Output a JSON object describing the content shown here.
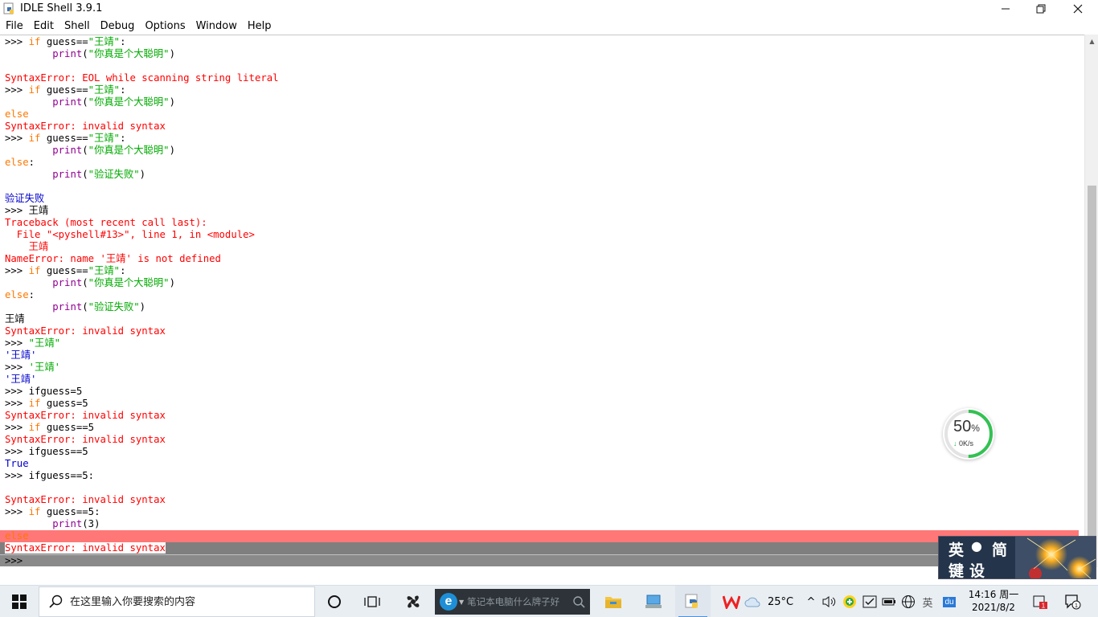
{
  "window": {
    "title": "IDLE Shell 3.9.1",
    "controls": {
      "minimize": "—",
      "restore": "❐",
      "close": "✕"
    }
  },
  "menu": [
    "File",
    "Edit",
    "Shell",
    "Debug",
    "Options",
    "Window",
    "Help"
  ],
  "shell": {
    "lines": [
      {
        "segs": [
          [
            "prompt",
            ">>> "
          ],
          [
            "kw",
            "if"
          ],
          [
            "plain",
            " guess=="
          ],
          [
            "str",
            "\"王靖\""
          ],
          [
            "plain",
            ":"
          ]
        ]
      },
      {
        "segs": [
          [
            "plain",
            "        "
          ],
          [
            "bi",
            "print"
          ],
          [
            "plain",
            "("
          ],
          [
            "str",
            "\"你真是个大聪明\""
          ],
          [
            "plain",
            ")"
          ]
        ]
      },
      {
        "segs": [
          [
            "plain",
            ""
          ]
        ]
      },
      {
        "segs": [
          [
            "err",
            "SyntaxError: EOL while scanning string literal"
          ]
        ]
      },
      {
        "segs": [
          [
            "prompt",
            ">>> "
          ],
          [
            "kw",
            "if"
          ],
          [
            "plain",
            " guess=="
          ],
          [
            "str",
            "\"王靖\""
          ],
          [
            "plain",
            ":"
          ]
        ]
      },
      {
        "segs": [
          [
            "plain",
            "        "
          ],
          [
            "bi",
            "print"
          ],
          [
            "plain",
            "("
          ],
          [
            "str",
            "\"你真是个大聪明\""
          ],
          [
            "plain",
            ")"
          ]
        ]
      },
      {
        "segs": [
          [
            "kw",
            "else"
          ]
        ]
      },
      {
        "segs": [
          [
            "err",
            "SyntaxError: invalid syntax"
          ]
        ]
      },
      {
        "segs": [
          [
            "prompt",
            ">>> "
          ],
          [
            "kw",
            "if"
          ],
          [
            "plain",
            " guess=="
          ],
          [
            "str",
            "\"王靖\""
          ],
          [
            "plain",
            ":"
          ]
        ]
      },
      {
        "segs": [
          [
            "plain",
            "        "
          ],
          [
            "bi",
            "print"
          ],
          [
            "plain",
            "("
          ],
          [
            "str",
            "\"你真是个大聪明\""
          ],
          [
            "plain",
            ")"
          ]
        ]
      },
      {
        "segs": [
          [
            "kw",
            "else"
          ],
          [
            "plain",
            ":"
          ]
        ]
      },
      {
        "segs": [
          [
            "plain",
            "        "
          ],
          [
            "bi",
            "print"
          ],
          [
            "plain",
            "("
          ],
          [
            "str",
            "\"验证失败\""
          ],
          [
            "plain",
            ")"
          ]
        ]
      },
      {
        "segs": [
          [
            "plain",
            ""
          ]
        ]
      },
      {
        "segs": [
          [
            "out",
            "验证失败"
          ]
        ]
      },
      {
        "segs": [
          [
            "prompt",
            ">>> "
          ],
          [
            "plain",
            "王靖"
          ]
        ]
      },
      {
        "segs": [
          [
            "err",
            "Traceback (most recent call last):"
          ]
        ]
      },
      {
        "segs": [
          [
            "err",
            "  File \"<pyshell#13>\", line 1, in <module>"
          ]
        ]
      },
      {
        "segs": [
          [
            "err",
            "    王靖"
          ]
        ]
      },
      {
        "segs": [
          [
            "err",
            "NameError: name '王靖' is not defined"
          ]
        ]
      },
      {
        "segs": [
          [
            "prompt",
            ">>> "
          ],
          [
            "kw",
            "if"
          ],
          [
            "plain",
            " guess=="
          ],
          [
            "str",
            "\"王靖\""
          ],
          [
            "plain",
            ":"
          ]
        ]
      },
      {
        "segs": [
          [
            "plain",
            "        "
          ],
          [
            "bi",
            "print"
          ],
          [
            "plain",
            "("
          ],
          [
            "str",
            "\"你真是个大聪明\""
          ],
          [
            "plain",
            ")"
          ]
        ]
      },
      {
        "segs": [
          [
            "kw",
            "else"
          ],
          [
            "plain",
            ":"
          ]
        ]
      },
      {
        "segs": [
          [
            "plain",
            "        "
          ],
          [
            "bi",
            "print"
          ],
          [
            "plain",
            "("
          ],
          [
            "str",
            "\"验证失败\""
          ],
          [
            "plain",
            ")"
          ]
        ]
      },
      {
        "segs": [
          [
            "plain",
            "王靖"
          ]
        ]
      },
      {
        "segs": [
          [
            "err",
            "SyntaxError: invalid syntax"
          ]
        ]
      },
      {
        "segs": [
          [
            "prompt",
            ">>> "
          ],
          [
            "str",
            "\"王靖\""
          ]
        ]
      },
      {
        "segs": [
          [
            "out",
            "'王靖'"
          ]
        ]
      },
      {
        "segs": [
          [
            "prompt",
            ">>> "
          ],
          [
            "str",
            "'王靖'"
          ]
        ]
      },
      {
        "segs": [
          [
            "out",
            "'王靖'"
          ]
        ]
      },
      {
        "segs": [
          [
            "prompt",
            ">>> "
          ],
          [
            "plain",
            "ifguess=5"
          ]
        ]
      },
      {
        "segs": [
          [
            "prompt",
            ">>> "
          ],
          [
            "kw",
            "if"
          ],
          [
            "plain",
            " guess=5"
          ]
        ]
      },
      {
        "segs": [
          [
            "err",
            "SyntaxError: invalid syntax"
          ]
        ]
      },
      {
        "segs": [
          [
            "prompt",
            ">>> "
          ],
          [
            "kw",
            "if"
          ],
          [
            "plain",
            " guess==5"
          ]
        ]
      },
      {
        "segs": [
          [
            "err",
            "SyntaxError: invalid syntax"
          ]
        ]
      },
      {
        "segs": [
          [
            "prompt",
            ">>> "
          ],
          [
            "plain",
            "ifguess==5"
          ]
        ]
      },
      {
        "segs": [
          [
            "out",
            "True"
          ]
        ]
      },
      {
        "segs": [
          [
            "prompt",
            ">>> "
          ],
          [
            "plain",
            "ifguess==5:"
          ]
        ]
      },
      {
        "segs": [
          [
            "plain",
            ""
          ]
        ]
      },
      {
        "segs": [
          [
            "err",
            "SyntaxError: invalid syntax"
          ]
        ]
      },
      {
        "segs": [
          [
            "prompt",
            ">>> "
          ],
          [
            "kw",
            "if"
          ],
          [
            "plain",
            " guess==5:"
          ]
        ]
      },
      {
        "segs": [
          [
            "plain",
            "        "
          ],
          [
            "bi",
            "print"
          ],
          [
            "plain",
            "(3)"
          ]
        ]
      },
      {
        "segs": [
          [
            "kw",
            "else"
          ]
        ],
        "hl": "hl-red"
      },
      {
        "segs": [
          [
            "err",
            "SyntaxError: invalid syntax"
          ]
        ],
        "hl": "hl-grey"
      },
      {
        "segs": [
          [
            "plain",
            ">>>"
          ]
        ],
        "hl": "status"
      }
    ]
  },
  "speed_widget": {
    "percent": "50",
    "percent_sign": "%",
    "arrow": "↓",
    "rate": "0K/s",
    "fill_fraction": 0.5
  },
  "ime": {
    "row1": [
      "英",
      "简"
    ],
    "row2": [
      "键",
      "设"
    ]
  },
  "taskbar": {
    "search_placeholder": "在这里输入你要搜索的内容",
    "web_search_text": "笔记本电脑什么牌子好",
    "weather": "25°C",
    "lang": "英",
    "du": "du",
    "time": "14:16 周一",
    "date": "2021/8/2",
    "notification_badge": "1",
    "action_center_badge": "1"
  },
  "colors": {
    "keyword": "#ff7700",
    "string": "#00aa00",
    "builtin": "#900090",
    "error": "#ff0000",
    "output": "#0000cc"
  }
}
